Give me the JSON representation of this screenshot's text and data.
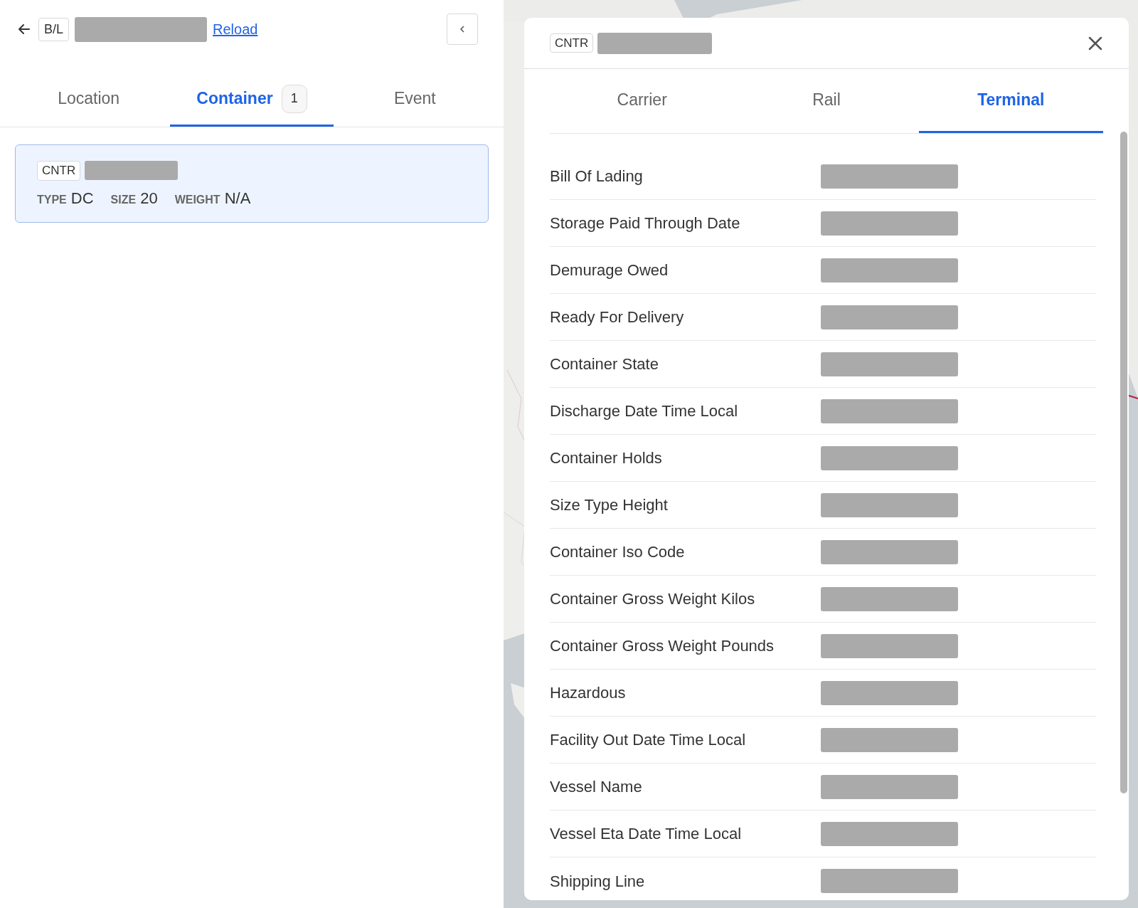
{
  "header": {
    "doc_tag": "B/L",
    "reload_link": "Reload"
  },
  "tabs": [
    {
      "label": "Location",
      "selected": false
    },
    {
      "label": "Container",
      "selected": true,
      "count": "1"
    },
    {
      "label": "Event",
      "selected": false
    }
  ],
  "container_card": {
    "selected": true,
    "tag": "CNTR",
    "fields": [
      {
        "label": "TYPE",
        "value": "DC"
      },
      {
        "label": "SIZE",
        "value": "20"
      },
      {
        "label": "WEIGHT",
        "value": "N/A"
      }
    ]
  },
  "detail_panel": {
    "tag": "CNTR",
    "tabs": [
      {
        "label": "Carrier",
        "selected": false
      },
      {
        "label": "Rail",
        "selected": false
      },
      {
        "label": "Terminal",
        "selected": true
      }
    ],
    "rows": [
      {
        "label": "Bill Of Lading"
      },
      {
        "label": "Storage Paid Through Date"
      },
      {
        "label": "Demurage Owed"
      },
      {
        "label": "Ready For Delivery"
      },
      {
        "label": "Container State"
      },
      {
        "label": "Discharge Date Time Local"
      },
      {
        "label": "Container Holds"
      },
      {
        "label": "Size Type Height"
      },
      {
        "label": "Container Iso Code"
      },
      {
        "label": "Container Gross Weight Kilos"
      },
      {
        "label": "Container Gross Weight Pounds"
      },
      {
        "label": "Hazardous"
      },
      {
        "label": "Facility Out Date Time Local"
      },
      {
        "label": "Vessel Name"
      },
      {
        "label": "Vessel Eta Date Time Local"
      },
      {
        "label": "Shipping Line"
      }
    ]
  }
}
